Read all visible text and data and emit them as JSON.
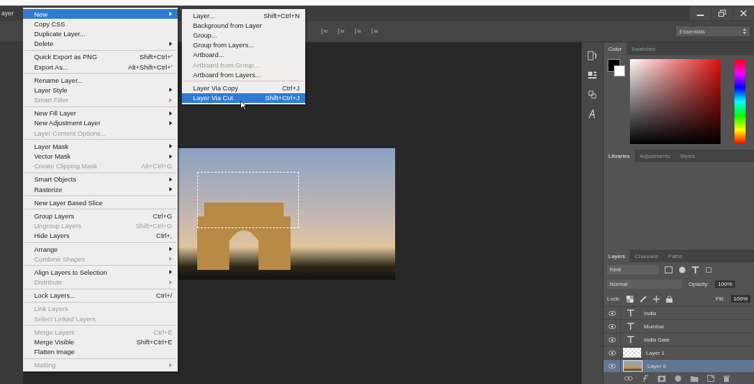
{
  "menu_bar": {
    "title": "ayer"
  },
  "options_bar": {
    "workspace": "Essentials"
  },
  "layer_menu": {
    "groups": [
      [
        {
          "label": "New",
          "submenu": true,
          "disabled": false,
          "selected": true
        },
        {
          "label": "Copy CSS",
          "submenu": false,
          "disabled": false,
          "selected": false
        },
        {
          "label": "Duplicate Layer...",
          "submenu": false,
          "disabled": false,
          "selected": false
        },
        {
          "label": "Delete",
          "submenu": true,
          "disabled": false,
          "selected": false
        }
      ],
      [
        {
          "label": "Quick Export as PNG",
          "shortcut": "Shift+Ctrl+'",
          "submenu": false,
          "disabled": false,
          "selected": false
        },
        {
          "label": "Export As...",
          "shortcut": "Alt+Shift+Ctrl+'",
          "submenu": false,
          "disabled": false,
          "selected": false
        }
      ],
      [
        {
          "label": "Rename Layer...",
          "submenu": false,
          "disabled": false,
          "selected": false
        },
        {
          "label": "Layer Style",
          "submenu": true,
          "disabled": false,
          "selected": false
        },
        {
          "label": "Smart Filter",
          "submenu": true,
          "disabled": true,
          "selected": false
        }
      ],
      [
        {
          "label": "New Fill Layer",
          "submenu": true,
          "disabled": false,
          "selected": false
        },
        {
          "label": "New Adjustment Layer",
          "submenu": true,
          "disabled": false,
          "selected": false
        },
        {
          "label": "Layer Content Options...",
          "submenu": false,
          "disabled": true,
          "selected": false
        }
      ],
      [
        {
          "label": "Layer Mask",
          "submenu": true,
          "disabled": false,
          "selected": false
        },
        {
          "label": "Vector Mask",
          "submenu": true,
          "disabled": false,
          "selected": false
        },
        {
          "label": "Create Clipping Mask",
          "shortcut": "Alt+Ctrl+G",
          "submenu": false,
          "disabled": true,
          "selected": false
        }
      ],
      [
        {
          "label": "Smart Objects",
          "submenu": true,
          "disabled": false,
          "selected": false
        },
        {
          "label": "Rasterize",
          "submenu": true,
          "disabled": false,
          "selected": false
        }
      ],
      [
        {
          "label": "New Layer Based Slice",
          "submenu": false,
          "disabled": false,
          "selected": false
        }
      ],
      [
        {
          "label": "Group Layers",
          "shortcut": "Ctrl+G",
          "submenu": false,
          "disabled": false,
          "selected": false
        },
        {
          "label": "Ungroup Layers",
          "shortcut": "Shift+Ctrl+G",
          "submenu": false,
          "disabled": true,
          "selected": false
        },
        {
          "label": "Hide Layers",
          "shortcut": "Ctrl+,",
          "submenu": false,
          "disabled": false,
          "selected": false
        }
      ],
      [
        {
          "label": "Arrange",
          "submenu": true,
          "disabled": false,
          "selected": false
        },
        {
          "label": "Combine Shapes",
          "submenu": true,
          "disabled": true,
          "selected": false
        }
      ],
      [
        {
          "label": "Align Layers to Selection",
          "submenu": true,
          "disabled": false,
          "selected": false
        },
        {
          "label": "Distribute",
          "submenu": true,
          "disabled": true,
          "selected": false
        }
      ],
      [
        {
          "label": "Lock Layers...",
          "shortcut": "Ctrl+/",
          "submenu": false,
          "disabled": false,
          "selected": false
        }
      ],
      [
        {
          "label": "Link Layers",
          "submenu": false,
          "disabled": true,
          "selected": false
        },
        {
          "label": "Select Linked Layers",
          "submenu": false,
          "disabled": true,
          "selected": false
        }
      ],
      [
        {
          "label": "Merge Layers",
          "shortcut": "Ctrl+E",
          "submenu": false,
          "disabled": true,
          "selected": false
        },
        {
          "label": "Merge Visible",
          "shortcut": "Shift+Ctrl+E",
          "submenu": false,
          "disabled": false,
          "selected": false
        },
        {
          "label": "Flatten Image",
          "submenu": false,
          "disabled": false,
          "selected": false
        }
      ],
      [
        {
          "label": "Matting",
          "submenu": true,
          "disabled": true,
          "selected": false
        }
      ]
    ]
  },
  "new_submenu": {
    "groups": [
      [
        {
          "label": "Layer...",
          "shortcut": "Shift+Ctrl+N",
          "submenu": false,
          "disabled": false,
          "selected": false
        },
        {
          "label": "Background from Layer",
          "submenu": false,
          "disabled": false,
          "selected": false
        },
        {
          "label": "Group...",
          "submenu": false,
          "disabled": false,
          "selected": false
        },
        {
          "label": "Group from Layers...",
          "submenu": false,
          "disabled": false,
          "selected": false
        },
        {
          "label": "Artboard...",
          "submenu": false,
          "disabled": false,
          "selected": false
        },
        {
          "label": "Artboard from Group...",
          "submenu": false,
          "disabled": true,
          "selected": false
        },
        {
          "label": "Artboard from Layers...",
          "submenu": false,
          "disabled": false,
          "selected": false
        }
      ],
      [
        {
          "label": "Layer Via Copy",
          "shortcut": "Ctrl+J",
          "submenu": false,
          "disabled": false,
          "selected": false
        },
        {
          "label": "Layer Via Cut",
          "shortcut": "Shift+Ctrl+J",
          "submenu": false,
          "disabled": false,
          "selected": true
        }
      ]
    ]
  },
  "color_panel": {
    "tabs": [
      {
        "label": "Color",
        "selected": true
      },
      {
        "label": "Swatches",
        "selected": false
      }
    ]
  },
  "libraries_panel": {
    "tabs": [
      {
        "label": "Libraries",
        "selected": true
      },
      {
        "label": "Adjustments",
        "selected": false
      },
      {
        "label": "Styles",
        "selected": false
      }
    ]
  },
  "layers_panel": {
    "tabs": [
      {
        "label": "Layers",
        "selected": true
      },
      {
        "label": "Channels",
        "selected": false
      },
      {
        "label": "Paths",
        "selected": false
      }
    ],
    "filter": "Kind",
    "blend_mode": "Normal",
    "opacity_label": "Opacity:",
    "opacity": "100%",
    "lock_label": "Lock:",
    "fill_label": "Fill:",
    "fill": "100%",
    "layers": [
      {
        "name": "India",
        "kind": "text",
        "visible": true,
        "selected": false
      },
      {
        "name": "Mumbai",
        "kind": "text",
        "visible": true,
        "selected": false
      },
      {
        "name": "India Gate",
        "kind": "text",
        "visible": true,
        "selected": false
      },
      {
        "name": "Layer 1",
        "kind": "transparent",
        "visible": true,
        "selected": false
      },
      {
        "name": "Layer 0",
        "kind": "image",
        "visible": true,
        "selected": true
      }
    ]
  }
}
